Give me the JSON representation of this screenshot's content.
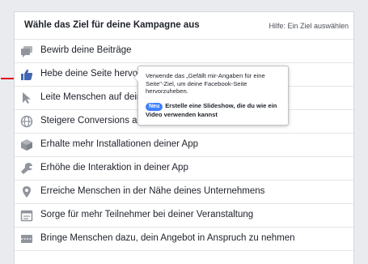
{
  "header": {
    "title": "Wähle das Ziel für deine Kampagne aus",
    "help": "Hilfe: Ein Ziel auswählen"
  },
  "objectives": [
    {
      "label": "Bewirb deine Beiträge",
      "icon": "speech-bubbles-icon"
    },
    {
      "label": "Hebe deine Seite hervor",
      "icon": "thumbs-up-icon"
    },
    {
      "label": "Leite Menschen auf deine",
      "icon": "cursor-icon"
    },
    {
      "label": "Steigere Conversions auf deiner Webseite",
      "icon": "globe-icon"
    },
    {
      "label": "Erhalte mehr Installationen deiner App",
      "icon": "box-icon"
    },
    {
      "label": "Erhöhe die Interaktion in deiner App",
      "icon": "wrench-icon"
    },
    {
      "label": "Erreiche Menschen in der Nähe deines Unternehmens",
      "icon": "location-pin-icon"
    },
    {
      "label": "Sorge für mehr Teilnehmer bei deiner Veranstaltung",
      "icon": "calendar-icon"
    },
    {
      "label": "Bringe Menschen dazu, dein Angebot in Anspruch zu nehmen",
      "icon": "tag-icon"
    }
  ],
  "tooltip": {
    "text": "Verwende das „Gefällt mir-Angaben für eine Seite\"-Ziel, um deine Facebook-Seite hervorzuheben.",
    "new_badge": "Neu",
    "new_text": "Erstelle eine Slideshow, die du wie ein Video verwenden kannst"
  },
  "colors": {
    "icon": "#90949c",
    "active_icon": "#4267b2",
    "arrow": "#e0001b",
    "badge": "#4080ff"
  }
}
